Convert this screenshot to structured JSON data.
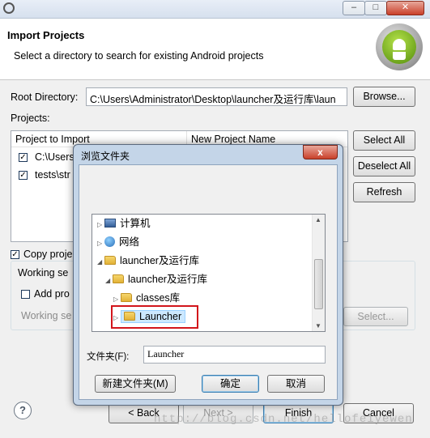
{
  "window": {
    "minimize": "–",
    "maximize": "□",
    "close": "✕"
  },
  "header": {
    "title": "Import Projects",
    "description": "Select a directory to search for existing Android projects"
  },
  "root_directory": {
    "label": "Root Directory:",
    "value": "C:\\Users\\Administrator\\Desktop\\launcher及运行库\\laun",
    "browse_label": "Browse..."
  },
  "projects": {
    "label": "Projects:",
    "columns": [
      "Project to Import",
      "New Project Name"
    ],
    "rows": [
      {
        "project": "C:\\Users",
        "checked": "✓"
      },
      {
        "project": "tests\\str",
        "checked": "✓"
      }
    ],
    "select_all": "Select All",
    "deselect_all": "Deselect All",
    "refresh": "Refresh"
  },
  "options": {
    "copy_label": "Copy proje",
    "copy_checked": "✓",
    "working_sets_label": "Working se",
    "add_label": "Add pro",
    "working_label": "Working se",
    "select_label": "Select..."
  },
  "footer": {
    "help": "?",
    "back": "< Back",
    "next": "Next >",
    "finish": "Finish",
    "cancel": "Cancel"
  },
  "folder_dialog": {
    "title": "浏览文件夹",
    "close": "x",
    "tree": [
      {
        "label": "计算机",
        "arrow": "▷"
      },
      {
        "label": "网络",
        "arrow": "▷"
      },
      {
        "label": "launcher及运行库",
        "arrow": "◢"
      },
      {
        "label": "launcher及运行库",
        "arrow": "◢"
      },
      {
        "label": "classes库",
        "arrow": "▷"
      },
      {
        "label": "Launcher",
        "arrow": "▷"
      }
    ],
    "folder_label": "文件夹(F):",
    "folder_value": "Launcher",
    "new_folder": "新建文件夹(M)",
    "ok": "确定",
    "cancel": "取消"
  },
  "watermark": "http://blog.csdn.net/hellofeiyewen"
}
